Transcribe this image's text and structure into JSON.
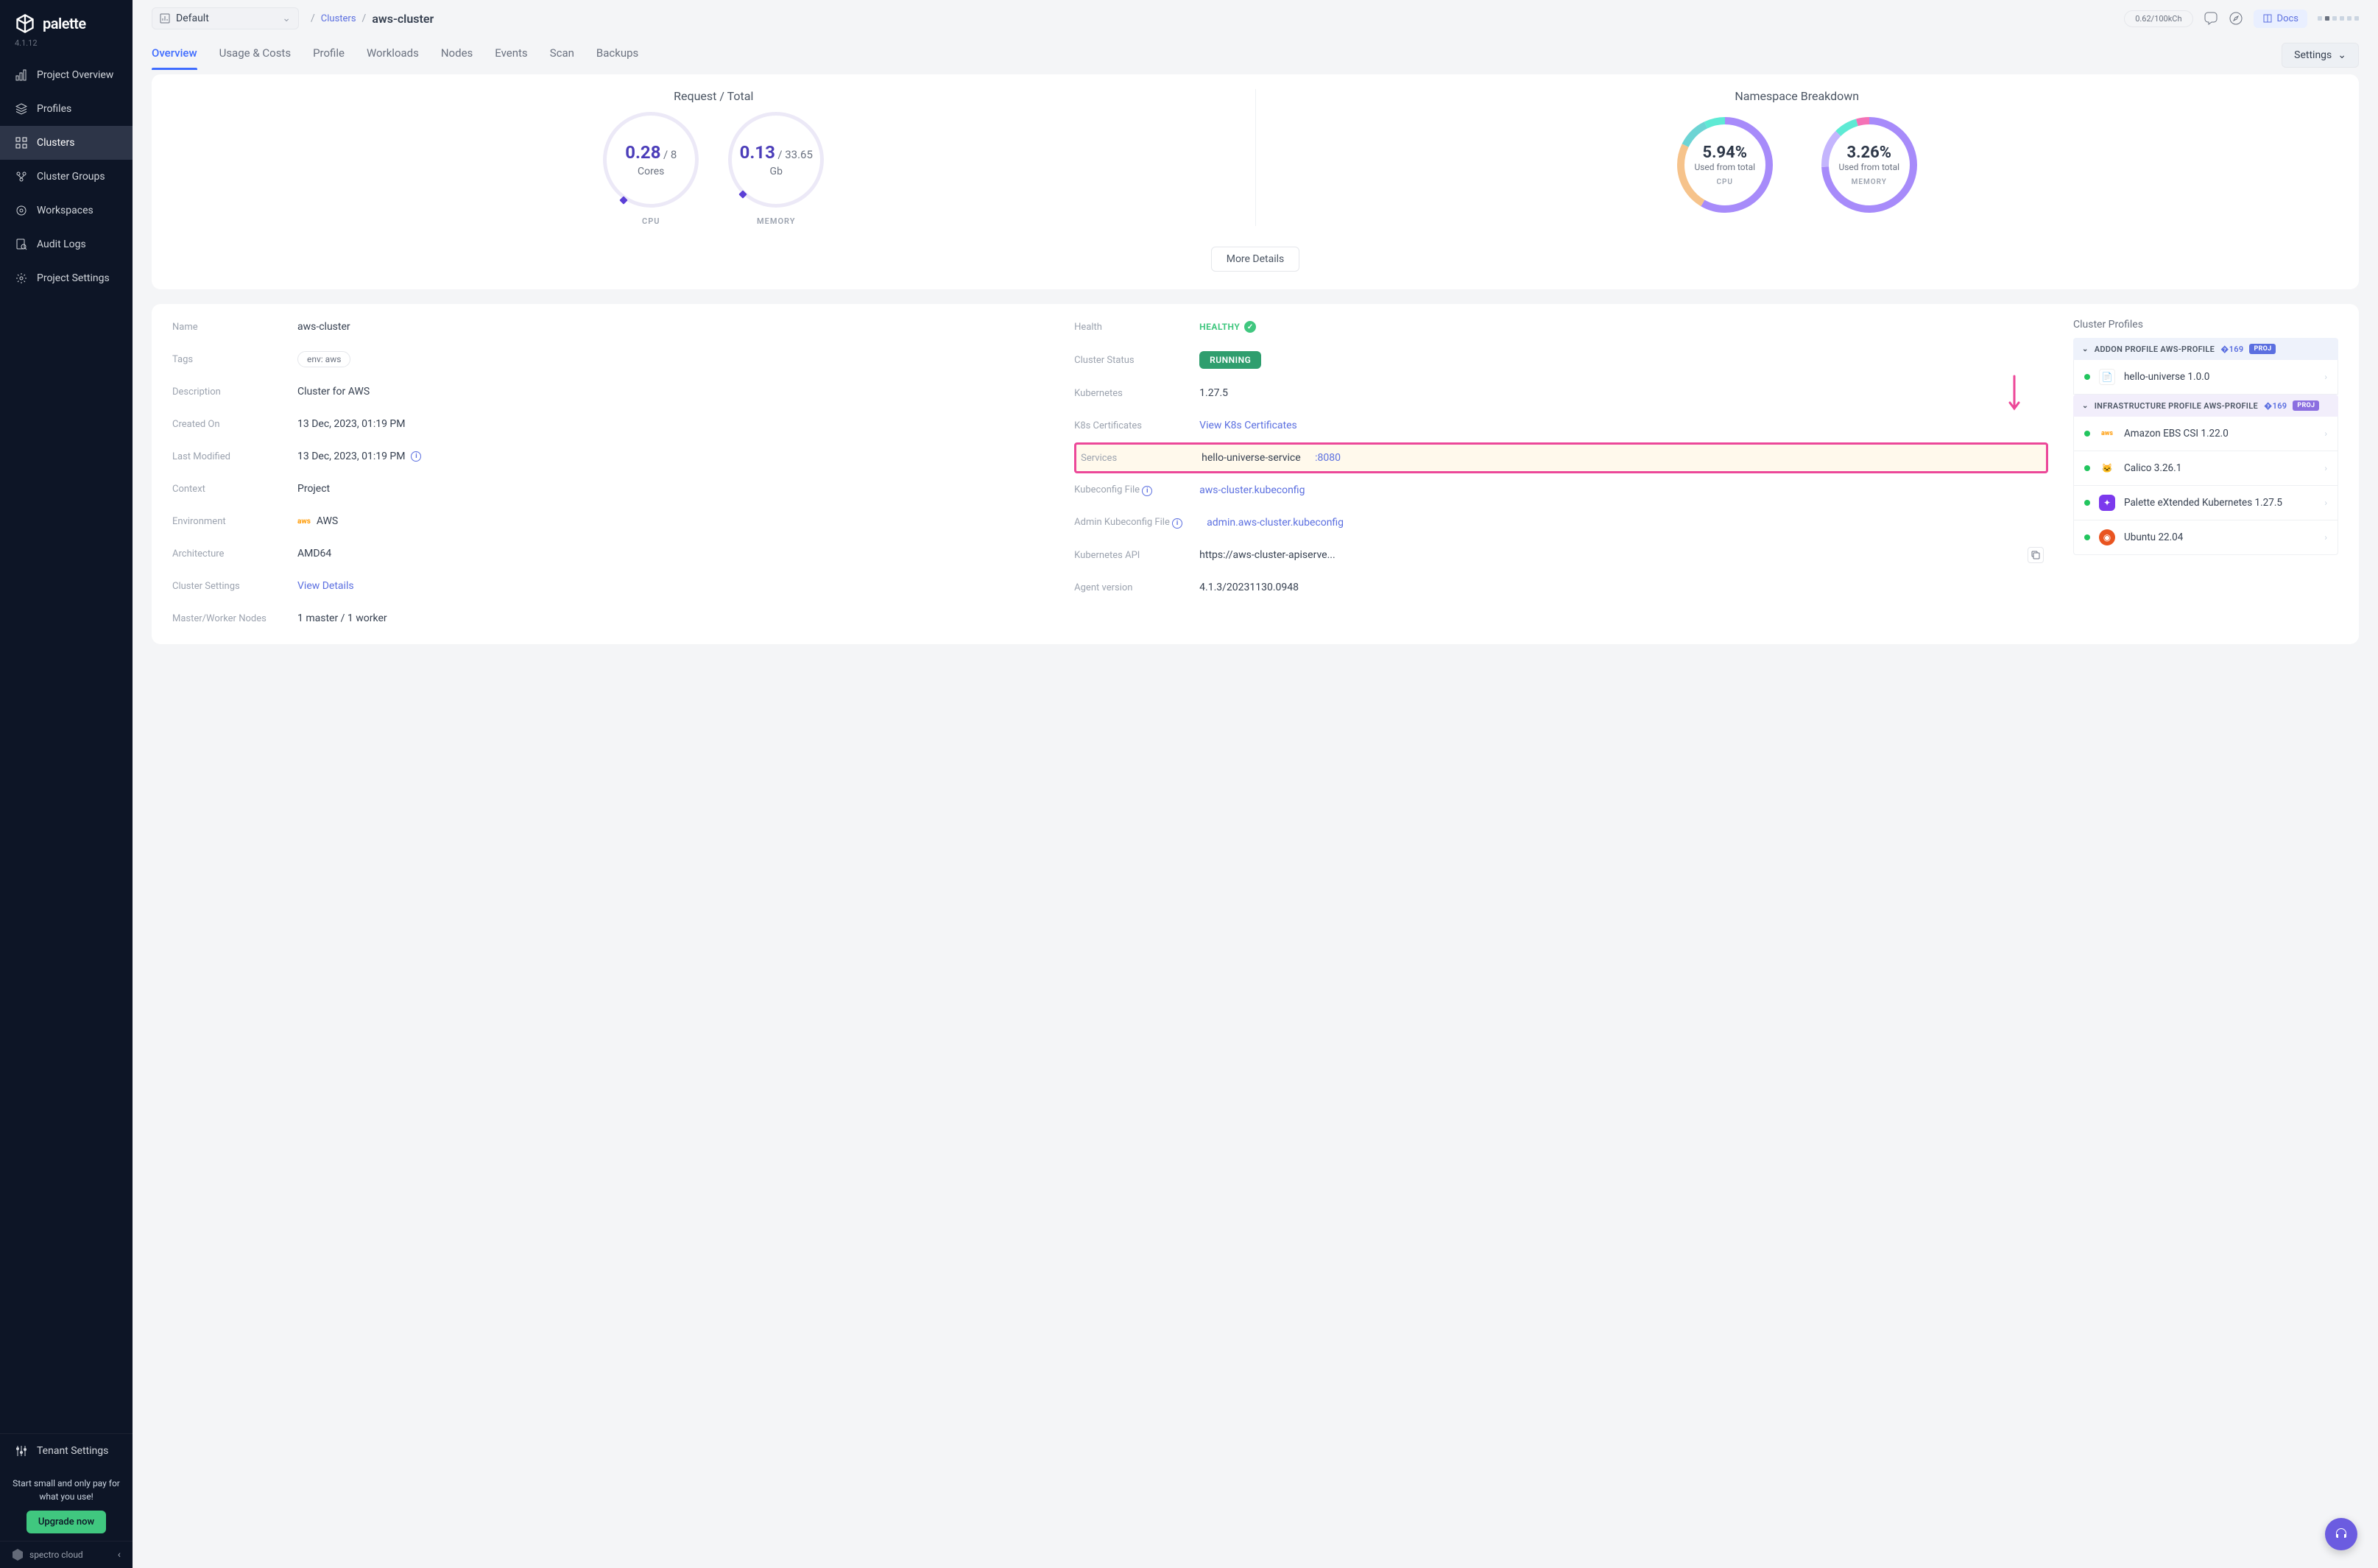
{
  "brand": {
    "name": "palette",
    "version": "4.1.12",
    "footer": "spectro cloud"
  },
  "sidebar": {
    "items": [
      {
        "label": "Project Overview"
      },
      {
        "label": "Profiles"
      },
      {
        "label": "Clusters"
      },
      {
        "label": "Cluster Groups"
      },
      {
        "label": "Workspaces"
      },
      {
        "label": "Audit Logs"
      },
      {
        "label": "Project Settings"
      }
    ],
    "tenant": "Tenant Settings",
    "promo": "Start small and only pay for what you use!",
    "upgrade": "Upgrade now"
  },
  "header": {
    "scope": "Default",
    "crumb_parent": "Clusters",
    "crumb_current": "aws-cluster",
    "usage": "0.62/100kCh",
    "docs": "Docs"
  },
  "tabs": [
    "Overview",
    "Usage & Costs",
    "Profile",
    "Workloads",
    "Nodes",
    "Events",
    "Scan",
    "Backups"
  ],
  "settings_btn": "Settings",
  "metrics": {
    "request_title": "Request / Total",
    "cpu": {
      "value": "0.28",
      "total": "/ 8",
      "unit": "Cores",
      "label": "CPU"
    },
    "mem": {
      "value": "0.13",
      "total": "/ 33.65",
      "unit": "Gb",
      "label": "MEMORY"
    },
    "ns_title": "Namespace Breakdown",
    "ns_cpu": {
      "pct": "5.94%",
      "sub": "Used from total",
      "label": "CPU"
    },
    "ns_mem": {
      "pct": "3.26%",
      "sub": "Used from total",
      "label": "MEMORY"
    },
    "more": "More Details"
  },
  "details": {
    "left": {
      "name_l": "Name",
      "name_v": "aws-cluster",
      "tags_l": "Tags",
      "tags_v": "env: aws",
      "desc_l": "Description",
      "desc_v": "Cluster for AWS",
      "created_l": "Created On",
      "created_v": "13 Dec, 2023, 01:19 PM",
      "mod_l": "Last Modified",
      "mod_v": "13 Dec, 2023, 01:19 PM",
      "ctx_l": "Context",
      "ctx_v": "Project",
      "env_l": "Environment",
      "env_v": "AWS",
      "arch_l": "Architecture",
      "arch_v": "AMD64",
      "cs_l": "Cluster Settings",
      "cs_v": "View Details",
      "mw_l": "Master/Worker Nodes",
      "mw_v": "1 master / 1 worker"
    },
    "mid": {
      "health_l": "Health",
      "health_v": "HEALTHY",
      "status_l": "Cluster Status",
      "status_v": "RUNNING",
      "k8s_l": "Kubernetes",
      "k8s_v": "1.27.5",
      "cert_l": "K8s Certificates",
      "cert_v": "View K8s Certificates",
      "svc_l": "Services",
      "svc_name": "hello-universe-service",
      "svc_port": ":8080",
      "kcfg_l": "Kubeconfig File",
      "kcfg_v": "aws-cluster.kubeconfig",
      "akcfg_l": "Admin Kubeconfig File",
      "akcfg_v": "admin.aws-cluster.kubeconfig",
      "api_l": "Kubernetes API",
      "api_v": "https://aws-cluster-apiserve...",
      "agent_l": "Agent version",
      "agent_v": "4.1.3/20231130.0948"
    }
  },
  "profiles": {
    "title": "Cluster Profiles",
    "addon_head": "ADDON PROFILE AWS-PROFILE",
    "infra_head": "INFRASTRUCTURE PROFILE AWS-PROFILE",
    "proj": "PROJ",
    "packs_addon": [
      {
        "name": "hello-universe 1.0.0",
        "icon_bg": "#fff",
        "icon_color": "#f56"
      }
    ],
    "packs_infra": [
      {
        "name": "Amazon EBS CSI 1.22.0",
        "icon_bg": "#fff",
        "icon_color": "#f90"
      },
      {
        "name": "Calico 3.26.1",
        "icon_bg": "#fff",
        "icon_color": "#2d8"
      },
      {
        "name": "Palette eXtended Kubernetes 1.27.5",
        "icon_bg": "#7c3aed",
        "icon_color": "#fff"
      },
      {
        "name": "Ubuntu 22.04",
        "icon_bg": "#e95420",
        "icon_color": "#fff"
      }
    ]
  }
}
